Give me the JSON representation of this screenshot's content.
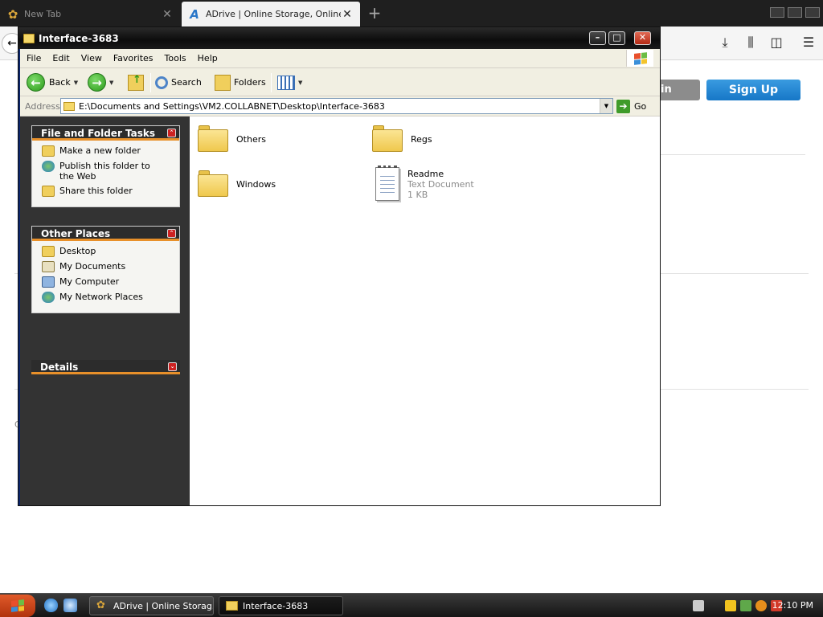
{
  "browser": {
    "tabs": [
      {
        "title": "New Tab",
        "state": "inactive"
      },
      {
        "title": "ADrive | Online Storage, Online Ba",
        "state": "active"
      }
    ],
    "site": {
      "login_label": "in",
      "signup_label": "Sign Up",
      "fragment_text": "C"
    }
  },
  "window": {
    "title": "Interface-3683",
    "menu": [
      "File",
      "Edit",
      "View",
      "Favorites",
      "Tools",
      "Help"
    ],
    "toolbar": {
      "back_label": "Back",
      "search_label": "Search",
      "folders_label": "Folders"
    },
    "address": {
      "label": "Address",
      "value": "E:\\Documents and Settings\\VM2.COLLABNET\\Desktop\\Interface-3683",
      "go_label": "Go"
    },
    "taskpane": {
      "file_folder_tasks": {
        "title": "File and Folder Tasks",
        "items": [
          "Make a new folder",
          "Publish this folder to the Web",
          "Share this folder"
        ]
      },
      "other_places": {
        "title": "Other Places",
        "items": [
          "Desktop",
          "My Documents",
          "My Computer",
          "My Network Places"
        ]
      },
      "details": {
        "title": "Details"
      }
    },
    "files": [
      {
        "name": "Others",
        "type": "folder"
      },
      {
        "name": "Regs",
        "type": "folder"
      },
      {
        "name": "Windows",
        "type": "folder"
      },
      {
        "name": "Readme",
        "type": "text",
        "kind": "Text Document",
        "size": "1 KB"
      }
    ]
  },
  "taskbar": {
    "buttons": [
      {
        "label": "ADrive | Online Storag...",
        "active": false
      },
      {
        "label": "Interface-3683",
        "active": true
      }
    ],
    "clock": "12:10 PM"
  },
  "colors": {
    "taskpane_bg": "#333333",
    "panel_header_accent": "#e8902a",
    "signup_blue": "#1677c7"
  }
}
